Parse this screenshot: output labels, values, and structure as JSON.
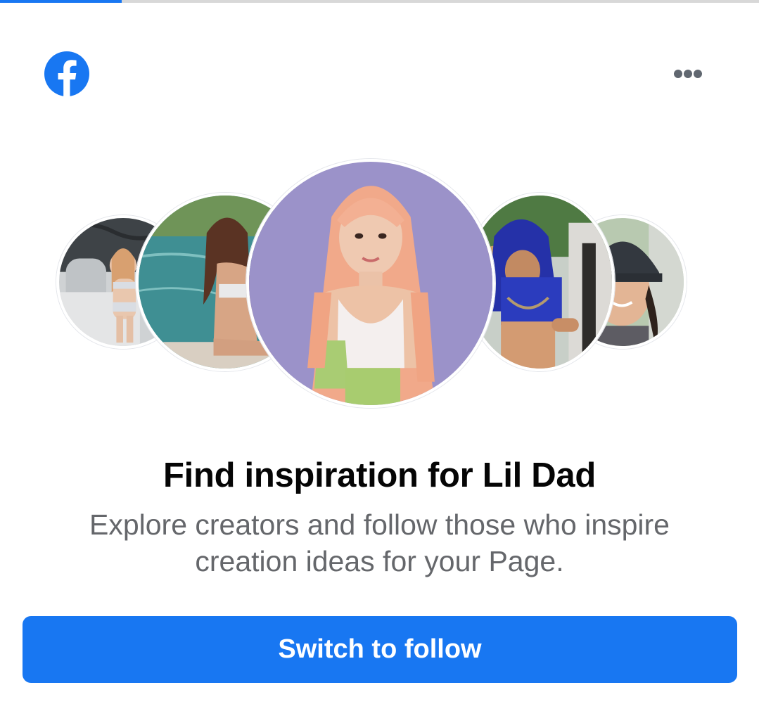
{
  "header": {
    "logo_icon": "facebook-logo-icon",
    "more_icon": "more-horizontal-icon",
    "progress_fraction": 0.16
  },
  "avatars": [
    {
      "icon": "creator-avatar-1"
    },
    {
      "icon": "creator-avatar-2"
    },
    {
      "icon": "creator-avatar-featured"
    },
    {
      "icon": "creator-avatar-4"
    },
    {
      "icon": "creator-avatar-5"
    }
  ],
  "content": {
    "title": "Find inspiration for Lil Dad",
    "subtitle": "Explore creators and follow those who inspire creation ideas for your Page."
  },
  "actions": {
    "primary_label": "Switch to follow"
  },
  "colors": {
    "brand": "#1877f2",
    "title": "#050505",
    "subtitle": "#65676b"
  }
}
